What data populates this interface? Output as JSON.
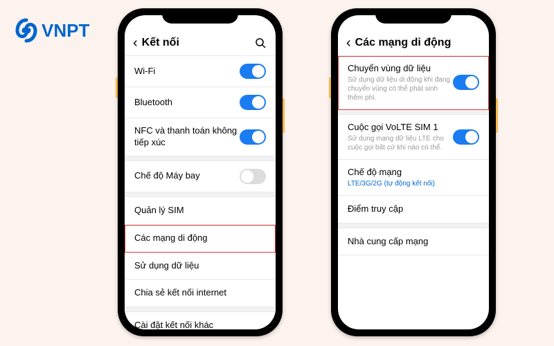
{
  "logo": {
    "text": "VNPT"
  },
  "phone1": {
    "header": {
      "title": "Kết nối"
    },
    "rows": {
      "wifi": "Wi-Fi",
      "bluetooth": "Bluetooth",
      "nfc": "NFC và thanh toán không tiếp xúc",
      "airplane": "Chế độ Máy bay",
      "sim": "Quản lý SIM",
      "mobile_networks": "Các mạng di động",
      "data_usage": "Sử dụng dữ liệu",
      "tethering": "Chia sẻ kết nối internet",
      "more": "Cài đặt kết nối khác"
    }
  },
  "phone2": {
    "header": {
      "title": "Các mạng di động"
    },
    "roaming": {
      "label": "Chuyển vùng dữ liệu",
      "sub": "Sử dụng dữ liệu di động khi đang chuyển vùng có thể phát sinh thêm phí."
    },
    "volte": {
      "label": "Cuộc gọi VoLTE SIM 1",
      "sub": "Sử dụng mạng dữ liệu LTE cho cuộc gọi bất cứ khi nào có thể."
    },
    "netmode": {
      "label": "Chế độ mạng",
      "sub": "LTE/3G/2G (tự động kết nối)"
    },
    "apn": {
      "label": "Điểm truy cập"
    },
    "operator": {
      "label": "Nhà cung cấp mạng"
    }
  }
}
